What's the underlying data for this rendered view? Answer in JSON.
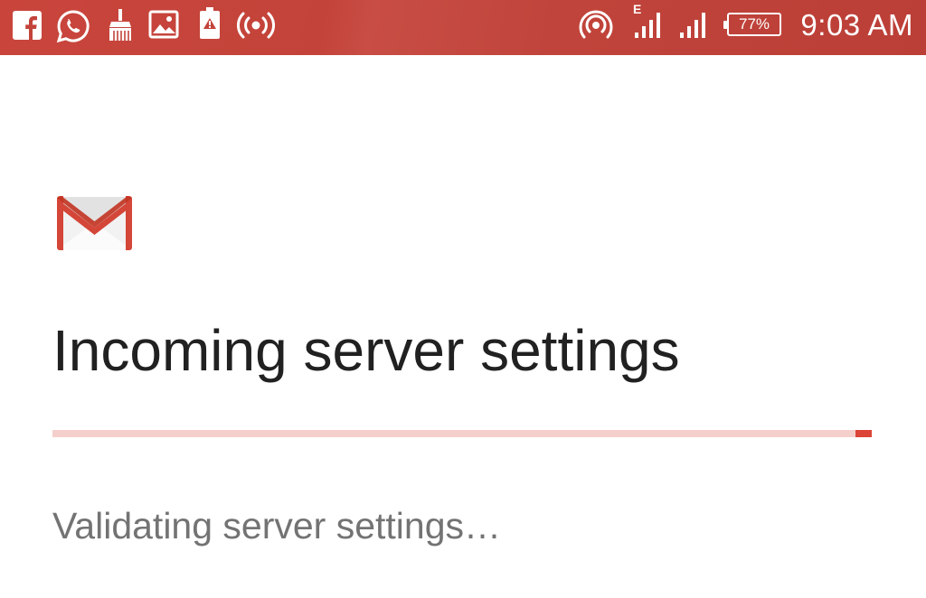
{
  "status_bar": {
    "left_icons": [
      "facebook-icon",
      "whatsapp-icon",
      "cleaner-broom-icon",
      "gallery-image-icon",
      "battery-warning-icon",
      "hotspot-broadcast-icon"
    ],
    "right_icons": [
      "portable-hotspot-icon",
      "signal-strength-icon",
      "signal-strength-icon",
      "battery-icon"
    ],
    "network_type": "E",
    "battery_level": "77%",
    "time": "9:03 AM",
    "background_color": "#c3433a"
  },
  "app": {
    "logo": "gmail-icon",
    "title": "Incoming server settings",
    "progress": {
      "state": "indeterminate",
      "visible_fill_fraction": 0.02,
      "track_color": "#f5cfcc",
      "fill_color": "#db4437"
    },
    "status_message": "Validating server settings…"
  }
}
